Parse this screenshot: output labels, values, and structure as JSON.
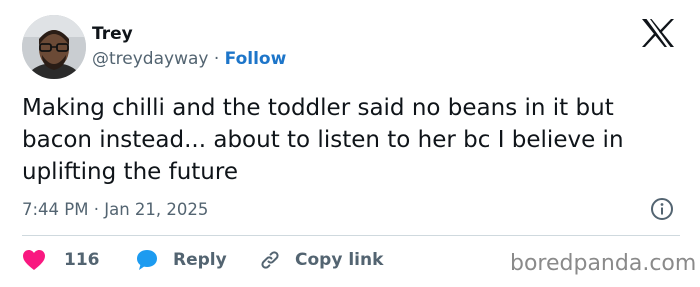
{
  "author": {
    "display_name": "Trey",
    "handle": "@treydayway",
    "separator": "·",
    "follow_label": "Follow"
  },
  "platform_logo": "x-logo",
  "tweet": {
    "text": "Making chilli and the toddler said no beans in it but bacon instead... about to listen to her bc I believe in uplifting the future",
    "timestamp": "7:44 PM · Jan 21, 2025"
  },
  "actions": {
    "likes_count": "116",
    "reply_label": "Reply",
    "copy_link_label": "Copy link"
  },
  "watermark": "boredpanda.com",
  "colors": {
    "like": "#f91880",
    "reply": "#1d9bf0",
    "link": "#1d75c9",
    "muted": "#536471",
    "text": "#0f1419"
  },
  "icons": {
    "like": "heart-icon",
    "reply": "speech-bubble-icon",
    "copy_link": "chain-link-icon",
    "info": "info-icon"
  }
}
